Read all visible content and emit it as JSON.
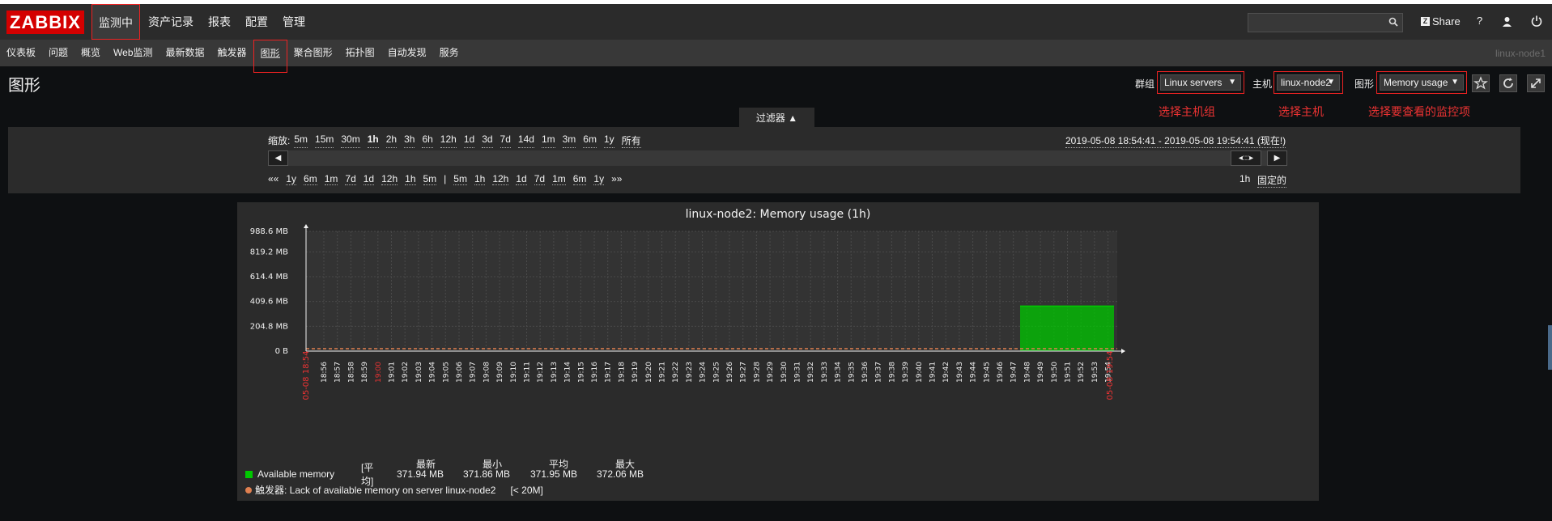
{
  "app": {
    "logo": "ZABBIX"
  },
  "main_nav": [
    "监测中",
    "资产记录",
    "报表",
    "配置",
    "管理"
  ],
  "header": {
    "share_label": "Share",
    "help": "?"
  },
  "sub_nav": [
    "仪表板",
    "问题",
    "概览",
    "Web监测",
    "最新数据",
    "触发器",
    "图形",
    "聚合图形",
    "拓扑图",
    "自动发现",
    "服务"
  ],
  "node_label": "linux-node1",
  "page": {
    "title": "图形"
  },
  "controls": {
    "group_label": "群组",
    "group_value": "Linux servers",
    "host_label": "主机",
    "host_value": "linux-node2",
    "graph_label": "图形",
    "graph_value": "Memory usage",
    "note_group": "选择主机组",
    "note_host": "选择主机",
    "note_graph": "选择要查看的监控项"
  },
  "filter": {
    "tab_label": "过滤器 ▲",
    "zoom_label": "缩放:",
    "zoom_options": [
      "5m",
      "15m",
      "30m",
      "1h",
      "2h",
      "3h",
      "6h",
      "12h",
      "1d",
      "3d",
      "7d",
      "14d",
      "1m",
      "3m",
      "6m",
      "1y",
      "所有"
    ],
    "range": "2019-05-08 18:54:41 - 2019-05-08 19:54:41 (现在!)",
    "back_nav": [
      "1y",
      "6m",
      "1m",
      "7d",
      "1d",
      "12h",
      "1h",
      "5m"
    ],
    "fwd_nav": [
      "5m",
      "1h",
      "12h",
      "1d",
      "7d",
      "1m",
      "6m",
      "1y"
    ],
    "back_arrows": "««",
    "fwd_arrows": "»»",
    "sep": "|",
    "period": "1h",
    "fixed_label": "固定的",
    "mid_handle": "◂:::▸"
  },
  "chart_data": {
    "type": "area",
    "title": "linux-node2: Memory usage (1h)",
    "y_ticks": [
      "988.6 MB",
      "819.2 MB",
      "614.4 MB",
      "409.6 MB",
      "204.8 MB",
      "0 B"
    ],
    "y_tick_values": [
      988.6,
      819.2,
      614.4,
      409.6,
      204.8,
      0
    ],
    "ylim": [
      0,
      988.6
    ],
    "x_ticks": [
      "18:56",
      "18:57",
      "18:58",
      "18:59",
      "19:00",
      "19:01",
      "19:02",
      "19:03",
      "19:04",
      "19:05",
      "19:06",
      "19:07",
      "19:08",
      "19:09",
      "19:10",
      "19:11",
      "19:12",
      "19:13",
      "19:14",
      "19:15",
      "19:16",
      "19:17",
      "19:18",
      "19:19",
      "19:20",
      "19:21",
      "19:22",
      "19:23",
      "19:24",
      "19:25",
      "19:26",
      "19:27",
      "19:28",
      "19:29",
      "19:30",
      "19:31",
      "19:32",
      "19:33",
      "19:34",
      "19:35",
      "19:36",
      "19:37",
      "19:38",
      "19:39",
      "19:40",
      "19:41",
      "19:42",
      "19:43",
      "19:44",
      "19:45",
      "19:46",
      "19:47",
      "19:48",
      "19:49",
      "19:50",
      "19:51",
      "19:52",
      "19:53",
      "19:54"
    ],
    "x_start_label": "05-08 18:54",
    "x_end_label": "05-08 19:54",
    "x_start": "18:54:41",
    "x_end": "19:54:41",
    "series": [
      {
        "name": "Available memory",
        "color": "#00c800",
        "x_from": "19:47:30",
        "x_to": "19:54:41",
        "value": 371.94
      }
    ],
    "trigger": {
      "name": "触发器: Lack of available memory on server linux-node2",
      "threshold_label": "[< 20M]",
      "value": 20,
      "color": "#e08050"
    },
    "legend": {
      "series_name": "Available memory",
      "func": "[平均]",
      "headers": [
        "最新",
        "最小",
        "平均",
        "最大"
      ],
      "values": [
        "371.94 MB",
        "371.86 MB",
        "371.95 MB",
        "372.06 MB"
      ]
    }
  },
  "colors": {
    "accent": "#d40000",
    "highlight": "#ee2222"
  }
}
